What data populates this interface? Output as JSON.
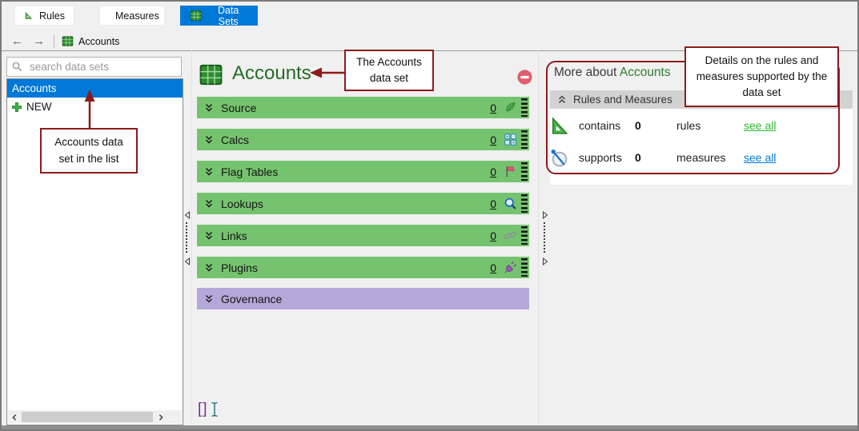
{
  "toolbar": {
    "tabs": [
      {
        "label": "Rules",
        "icon": "rules-triangle-icon",
        "active": false
      },
      {
        "label": "Measures",
        "icon": "measures-compass-icon",
        "active": false
      },
      {
        "label": "Data Sets",
        "icon": "data-sets-table-icon",
        "active": true
      }
    ]
  },
  "navbar": {
    "back_glyph": "←",
    "forward_glyph": "→",
    "breadcrumb": "Accounts"
  },
  "sidebar": {
    "search_placeholder": "search data sets",
    "items": [
      {
        "label": "Accounts",
        "selected": true
      },
      {
        "label": "NEW",
        "icon": "plus-icon",
        "selected": false
      }
    ],
    "annotation": "Accounts data set in the list"
  },
  "main": {
    "title": "Accounts",
    "annotation": "The Accounts data set",
    "sections": [
      {
        "label": "Source",
        "count": "0",
        "icon": "leaf-icon",
        "color": "green"
      },
      {
        "label": "Calcs",
        "count": "0",
        "icon": "calc-grid-icon",
        "color": "green"
      },
      {
        "label": "Flag Tables",
        "count": "0",
        "icon": "flag-icon",
        "color": "green"
      },
      {
        "label": "Lookups",
        "count": "0",
        "icon": "lookup-magnifier-icon",
        "color": "green"
      },
      {
        "label": "Links",
        "count": "0",
        "icon": "link-chain-icon",
        "color": "green"
      },
      {
        "label": "Plugins",
        "count": "0",
        "icon": "plug-icon",
        "color": "green"
      },
      {
        "label": "Governance",
        "color": "purple"
      }
    ],
    "footer_glyph": "[]"
  },
  "details": {
    "header_prefix": "More about ",
    "header_name": "Accounts",
    "annotation": "Details on the rules and measures supported by the data set",
    "section_label": "Rules and Measures",
    "rows": [
      {
        "icon": "rules-triangle-icon",
        "verb": "contains",
        "count": "0",
        "noun": "rules",
        "link": "see all",
        "link_color": "#2eb52e"
      },
      {
        "icon": "measures-compass-icon",
        "verb": "supports",
        "count": "0",
        "noun": "measures",
        "link": "see all",
        "link_color": "#0078d7"
      }
    ]
  },
  "colors": {
    "accent_blue": "#0078d7",
    "section_green": "#76c36f",
    "governance_purple": "#b4a8d9",
    "callout_red": "#8c1c1c",
    "title_green": "#266b26"
  }
}
